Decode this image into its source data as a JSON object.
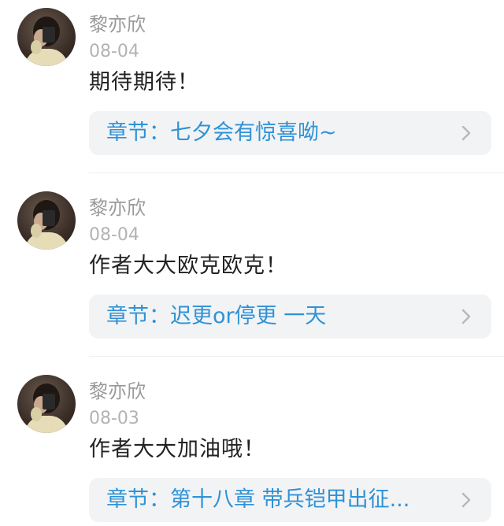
{
  "comments": [
    {
      "username": "黎亦欣",
      "date": "08-04",
      "text": "期待期待！",
      "chapter": "章节：七夕会有惊喜呦~"
    },
    {
      "username": "黎亦欣",
      "date": "08-04",
      "text": "作者大大欧克欧克！",
      "chapter": "章节：迟更or停更 一天"
    },
    {
      "username": "黎亦欣",
      "date": "08-03",
      "text": "作者大大加油哦！",
      "chapter": "章节：第十八章 带兵铠甲出征..."
    }
  ],
  "colors": {
    "chapter_link": "#2f92d6",
    "card_bg": "#f2f3f5",
    "username": "#9a9a9a",
    "date": "#b3b3b3",
    "text": "#222222"
  },
  "icons": {
    "avatar": "user-avatar-photo",
    "chevron": "chevron-right-icon"
  }
}
